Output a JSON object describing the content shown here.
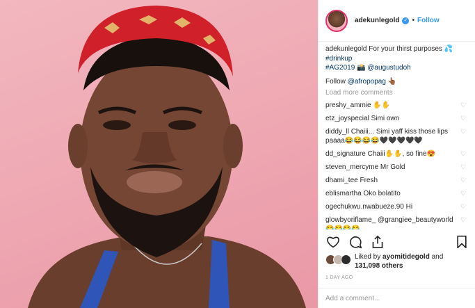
{
  "post": {
    "username": "adekunlegold",
    "follow_label": "Follow",
    "dot": "•",
    "caption_user": "adekunlegold",
    "caption_text": "For your thirst purposes 💦",
    "hashtag1": "#drinkup",
    "hashtag2": "#AG2019",
    "caption_mid": "📸",
    "mention1": "@augustudoh",
    "follow_prefix": "Follow",
    "mention2": "@afropopag",
    "follow_suffix": "👆🏾",
    "load_more": "Load more comments",
    "comments": [
      {
        "user": "preshy_ammie",
        "text": "✋✋"
      },
      {
        "user": "etz_joyspecial",
        "text": "Simi own"
      },
      {
        "user": "diddy_ll",
        "text": "Chaiii... Simi yaff kiss those lips paaaa😂😂😂😂🖤🖤🖤🖤🖤"
      },
      {
        "user": "dd_signature",
        "text": "Chaiii✋✋, so fine😍"
      },
      {
        "user": "steven_mercyme",
        "text": "Mr Gold"
      },
      {
        "user": "dhami_tee",
        "text": "Fresh"
      },
      {
        "user": "eblismartha",
        "text": "Oko bolatito"
      },
      {
        "user": "ogechukwu.nwabueze.90",
        "text": "Hi"
      },
      {
        "user": "glowbyoriflame_",
        "text": "@grangiee_beautyworld 😂😂😂😂"
      }
    ],
    "liked_prefix": "Liked by",
    "liked_user": "ayomitidegold",
    "liked_and": "and",
    "liked_count": "131,098 others",
    "timestamp": "1 DAY AGO",
    "add_comment_placeholder": "Add a comment..."
  },
  "icons": [
    "heart-icon",
    "comment-icon",
    "share-icon",
    "bookmark-icon",
    "verified-badge-icon"
  ],
  "colors": {
    "link": "#003569",
    "follow": "#3897f0",
    "background_pink": "#efaab4",
    "muted": "#999999"
  }
}
